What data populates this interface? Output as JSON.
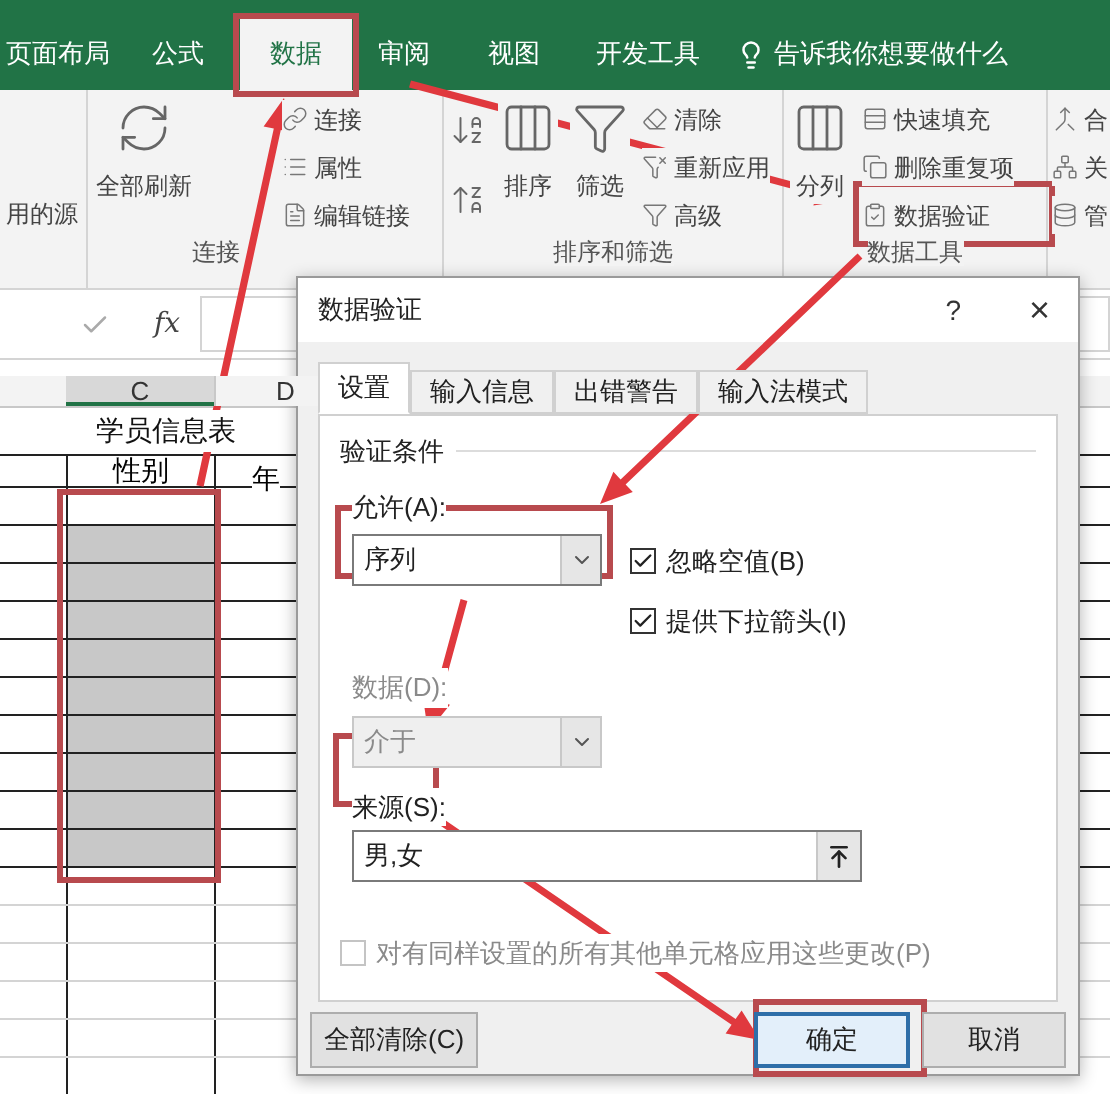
{
  "ribbon_tabs": [
    {
      "label": "页面布局",
      "selected": false
    },
    {
      "label": "公式",
      "selected": false
    },
    {
      "label": "数据",
      "selected": true
    },
    {
      "label": "审阅",
      "selected": false
    },
    {
      "label": "视图",
      "selected": false
    },
    {
      "label": "开发工具",
      "selected": false
    }
  ],
  "tell_me": "告诉我你想要做什么",
  "ribbon_groups": [
    {
      "items": [
        {
          "kind": "text",
          "label": "用的源"
        }
      ]
    },
    {
      "label": "连接",
      "items": [
        {
          "kind": "large",
          "label": "全部刷新"
        },
        {
          "kind": "small",
          "label": "连接"
        },
        {
          "kind": "small",
          "label": "属性"
        },
        {
          "kind": "small",
          "label": "编辑链接"
        }
      ]
    },
    {
      "label": "排序和筛选",
      "items": [
        {
          "kind": "icon"
        },
        {
          "kind": "icon"
        },
        {
          "kind": "large",
          "label": "排序"
        },
        {
          "kind": "large",
          "label": "筛选"
        },
        {
          "kind": "small",
          "label": "清除"
        },
        {
          "kind": "small",
          "label": "重新应用"
        },
        {
          "kind": "small",
          "label": "高级"
        }
      ]
    },
    {
      "label": "数据工具",
      "items": [
        {
          "kind": "large",
          "label": "分列"
        },
        {
          "kind": "small",
          "label": "快速填充"
        },
        {
          "kind": "small",
          "label": "删除重复项"
        },
        {
          "kind": "small",
          "label": "数据验证"
        }
      ]
    },
    {
      "items": [
        {
          "kind": "small",
          "label": "合"
        },
        {
          "kind": "small",
          "label": "关"
        },
        {
          "kind": "small",
          "label": "管"
        }
      ]
    }
  ],
  "formula_bar": {
    "function_label": "fx"
  },
  "sheet": {
    "columns": [
      "C",
      "D"
    ],
    "title": "学员信息表",
    "headers": [
      "性别",
      "年"
    ]
  },
  "dialog": {
    "title": "数据验证",
    "help": "?",
    "close": "×",
    "tabs": [
      {
        "label": "设置",
        "selected": true
      },
      {
        "label": "输入信息",
        "selected": false
      },
      {
        "label": "出错警告",
        "selected": false
      },
      {
        "label": "输入法模式",
        "selected": false
      }
    ],
    "section": "验证条件",
    "allow": {
      "label": "允许(A):",
      "value": "序列",
      "disabled": false
    },
    "options": [
      {
        "label": "忽略空值(B)",
        "checked": true,
        "disabled": false
      },
      {
        "label": "提供下拉箭头(I)",
        "checked": true,
        "disabled": false
      }
    ],
    "data": {
      "label": "数据(D):",
      "value": "介于",
      "disabled": true
    },
    "source": {
      "label": "来源(S):",
      "value": "男,女"
    },
    "apply_all": {
      "label": "对有同样设置的所有其他单元格应用这些更改(P)",
      "checked": false,
      "disabled": true
    },
    "buttons": [
      {
        "label": "全部清除(C)",
        "kind": "secondary"
      },
      {
        "label": "确定",
        "kind": "primary"
      },
      {
        "label": "取消",
        "kind": "secondary"
      }
    ]
  }
}
